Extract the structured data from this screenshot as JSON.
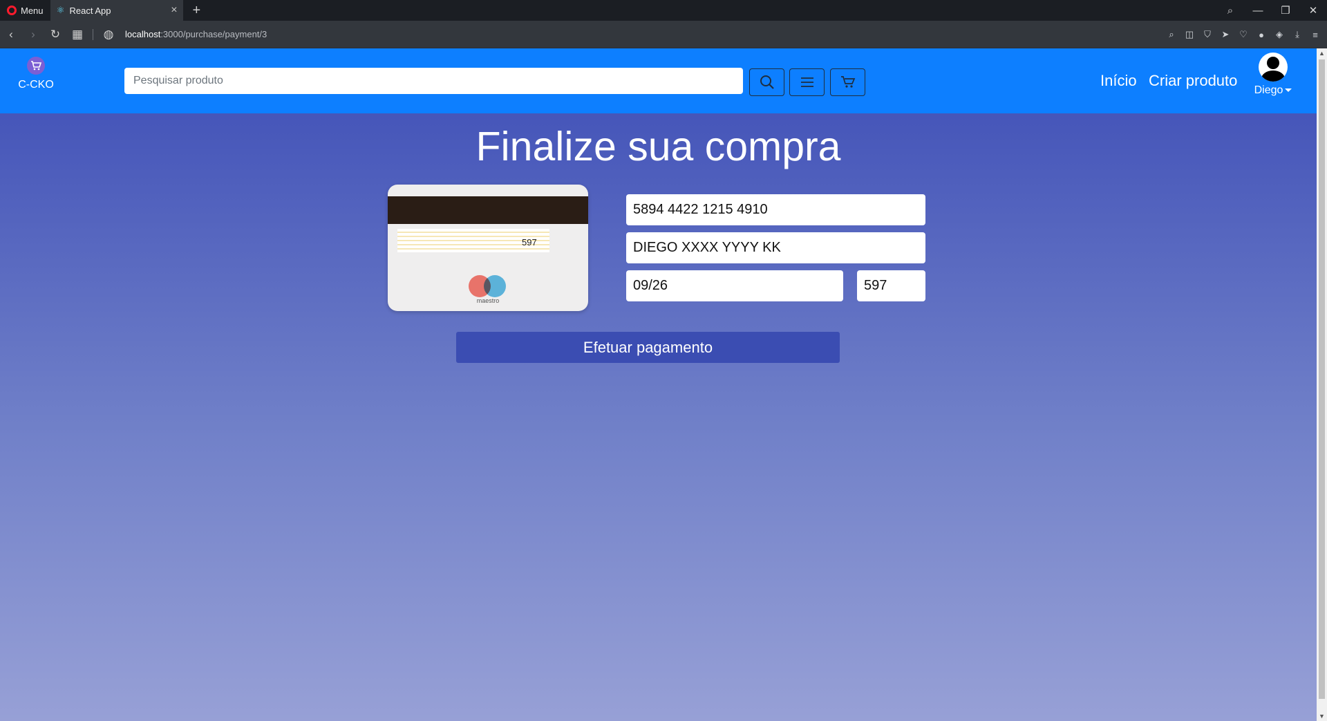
{
  "browser": {
    "menu_label": "Menu",
    "tab_title": "React App",
    "url_host": "localhost",
    "url_path": ":3000/purchase/payment/3"
  },
  "navbar": {
    "brand_name": "C-CKO",
    "search_placeholder": "Pesquisar produto",
    "links": {
      "home": "Início",
      "create_product": "Criar produto"
    },
    "user_name": "Diego"
  },
  "payment": {
    "title": "Finalize sua compra",
    "card_number": "5894 4422 1215 4910",
    "card_name": "DIEGO XXXX YYYY KK",
    "card_expiry": "09/26",
    "card_cvv": "597",
    "card_brand": "maestro",
    "submit_label": "Efetuar pagamento"
  }
}
